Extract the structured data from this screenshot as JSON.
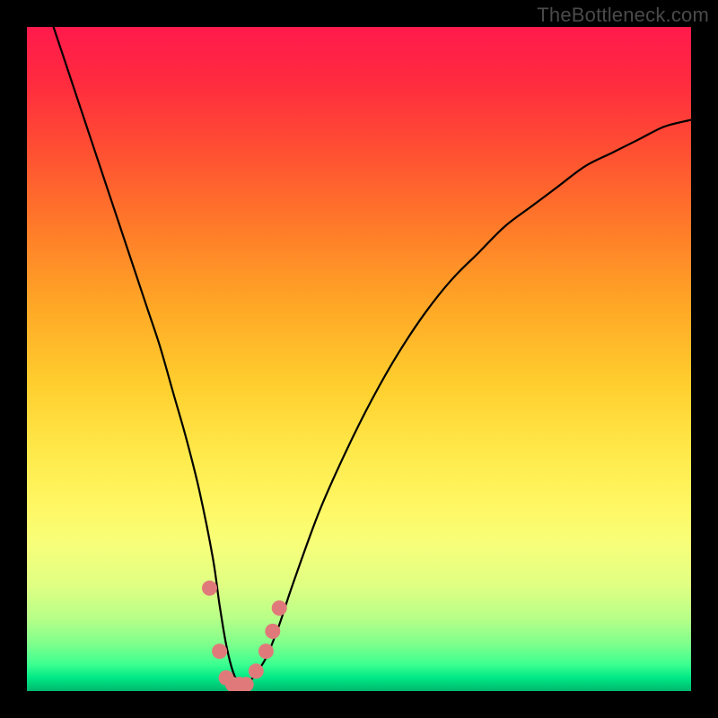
{
  "watermark": "TheBottleneck.com",
  "chart_data": {
    "type": "line",
    "title": "",
    "xlabel": "",
    "ylabel": "",
    "xlim": [
      0,
      100
    ],
    "ylim": [
      0,
      100
    ],
    "grid": false,
    "legend": false,
    "background_gradient": {
      "direction": "vertical",
      "stops": [
        {
          "pos": 0.0,
          "color": "#ff1a4d"
        },
        {
          "pos": 0.5,
          "color": "#ffcf2e"
        },
        {
          "pos": 0.82,
          "color": "#f7ff7a"
        },
        {
          "pos": 0.95,
          "color": "#3bff90"
        },
        {
          "pos": 1.0,
          "color": "#00b86e"
        }
      ]
    },
    "series": [
      {
        "name": "bottleneck-curve",
        "color": "#000000",
        "x": [
          4,
          6,
          8,
          10,
          12,
          14,
          16,
          18,
          20,
          22,
          24,
          26,
          28,
          29,
          30,
          31,
          32,
          33,
          34,
          36,
          38,
          40,
          44,
          48,
          52,
          56,
          60,
          64,
          68,
          72,
          76,
          80,
          84,
          88,
          92,
          96,
          100
        ],
        "y": [
          100,
          94,
          88,
          82,
          76,
          70,
          64,
          58,
          52,
          45,
          38,
          30,
          20,
          13,
          7,
          3,
          1,
          1,
          2,
          5,
          10,
          16,
          27,
          36,
          44,
          51,
          57,
          62,
          66,
          70,
          73,
          76,
          79,
          81,
          83,
          85,
          86
        ]
      },
      {
        "name": "highlight-dots",
        "color": "#e07a7a",
        "type": "scatter",
        "x": [
          27.5,
          29.0,
          30.0,
          31.0,
          32.0,
          33.0,
          34.5,
          36.0,
          37.0,
          38.0
        ],
        "y": [
          15.5,
          6.0,
          2.0,
          1.0,
          1.0,
          1.0,
          3.0,
          6.0,
          9.0,
          12.5
        ]
      }
    ],
    "annotations": []
  }
}
